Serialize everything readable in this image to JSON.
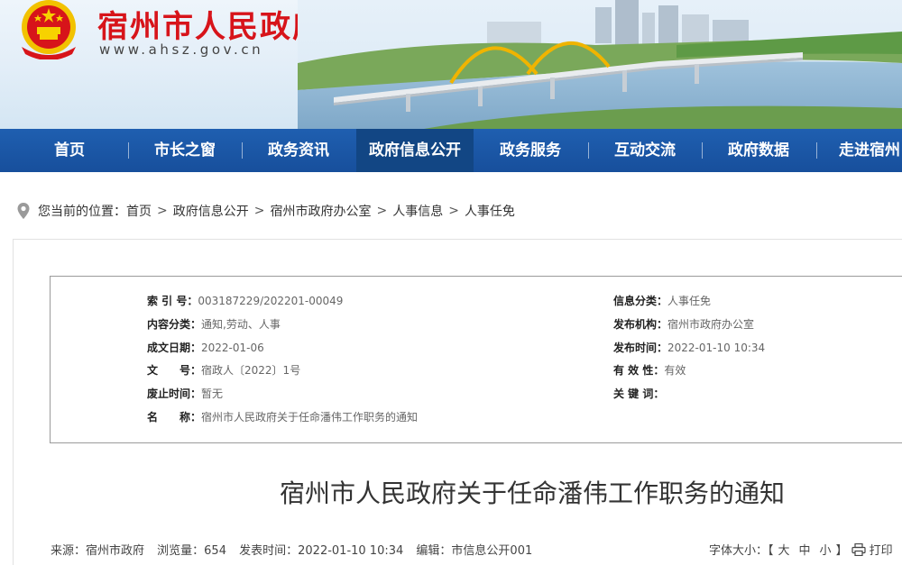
{
  "header": {
    "title": "宿州市人民政府",
    "url": "www.ahsz.gov.cn"
  },
  "nav": {
    "items": [
      {
        "label": "首页"
      },
      {
        "label": "市长之窗"
      },
      {
        "label": "政务资讯"
      },
      {
        "label": "政府信息公开"
      },
      {
        "label": "政务服务"
      },
      {
        "label": "互动交流"
      },
      {
        "label": "政府数据"
      },
      {
        "label": "走进宿州"
      }
    ],
    "active_index": 3
  },
  "breadcrumb": {
    "prefix": "您当前的位置：",
    "items": [
      "首页",
      "政府信息公开",
      "宿州市政府办公室",
      "人事信息",
      "人事任免"
    ],
    "separator": ">"
  },
  "meta": {
    "index_no": {
      "label": "索 引 号：",
      "value": "003187229/202201-00049"
    },
    "category": {
      "label": "内容分类：",
      "value": "通知,劳动、人事"
    },
    "created": {
      "label": "成文日期：",
      "value": "2022-01-06"
    },
    "doc_no": {
      "label": "文　　号：",
      "value": "宿政人〔2022〕1号"
    },
    "expiry": {
      "label": "废止时间：",
      "value": "暂无"
    },
    "name": {
      "label": "名　　称：",
      "value": "宿州市人民政府关于任命潘伟工作职务的通知"
    },
    "info_class": {
      "label": "信息分类：",
      "value": "人事任免"
    },
    "publisher": {
      "label": "发布机构：",
      "value": "宿州市政府办公室"
    },
    "published": {
      "label": "发布时间：",
      "value": "2022-01-10 10:34"
    },
    "validity": {
      "label": "有 效 性：",
      "value": "有效"
    },
    "keywords": {
      "label": "关 键 词：",
      "value": ""
    }
  },
  "document": {
    "title": "宿州市人民政府关于任命潘伟工作职务的通知"
  },
  "info_bar": {
    "source": "来源：宿州市政府",
    "views": "浏览量：654",
    "time": "发表时间：2022-01-10 10:34",
    "editor": "编辑：市信息公开001",
    "font_size_label": "字体大小：【",
    "font_large": "大",
    "font_medium": "中",
    "font_small": "小",
    "font_close": "】",
    "print_label": "打印"
  },
  "colors": {
    "brand_red": "#d7141a",
    "nav_blue": "#1f5fb0",
    "nav_active": "#124684"
  },
  "icons": {
    "emblem": "national-emblem-icon",
    "pin": "location-pin-icon",
    "print": "printer-icon"
  }
}
